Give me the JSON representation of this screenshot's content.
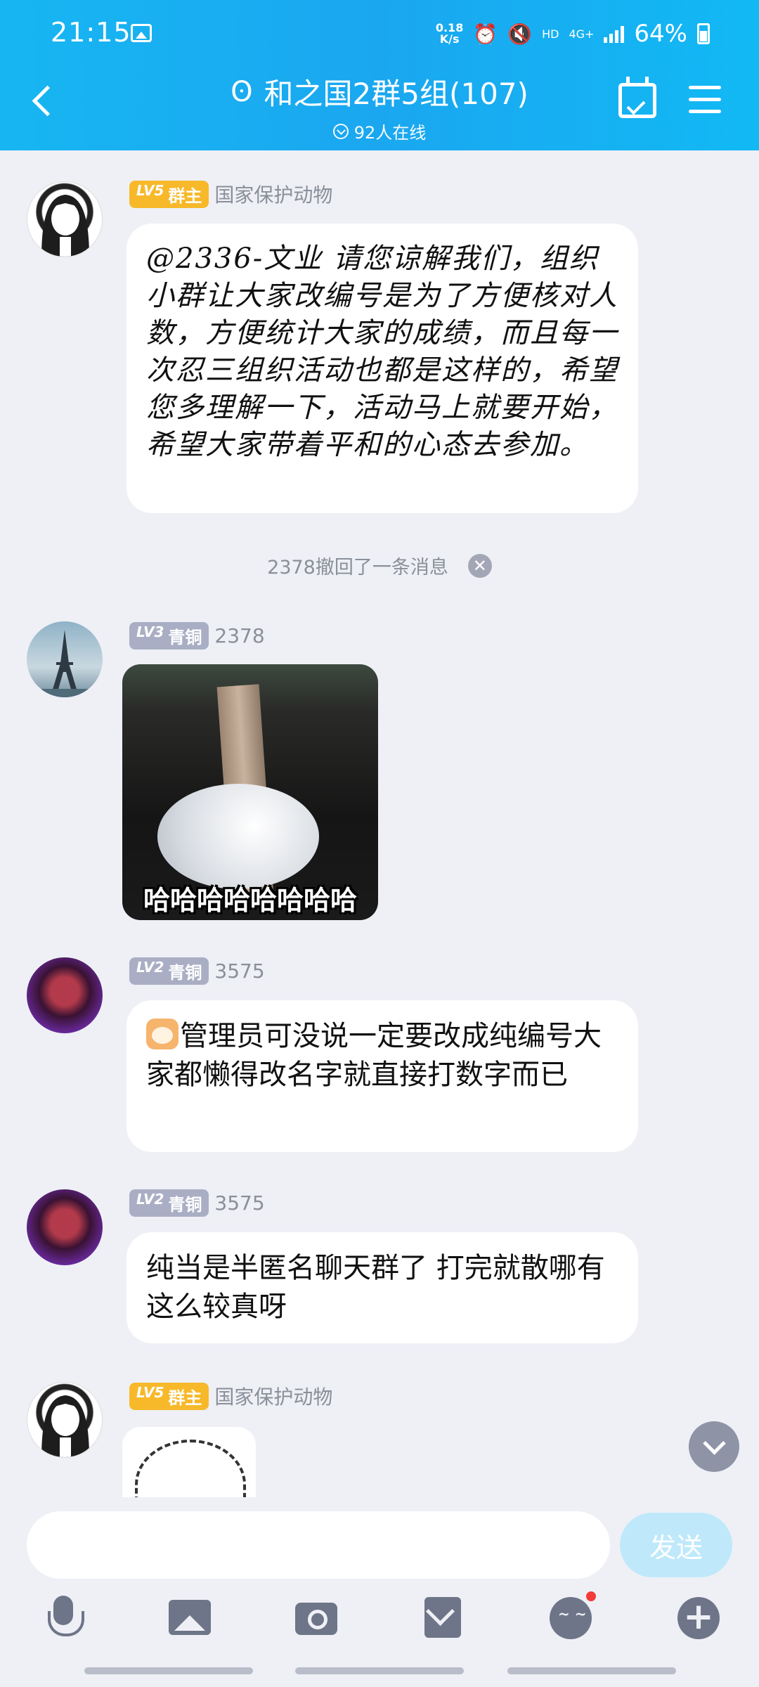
{
  "status_bar": {
    "time": "21:15",
    "speed_value": "0.18",
    "speed_unit": "K/s",
    "hd": "HD",
    "network": "4G+",
    "battery": "64%"
  },
  "header": {
    "title": "和之国2群5组(107)",
    "online": "92人在线"
  },
  "messages": [
    {
      "level": "LV5",
      "role": "群主",
      "name": "国家保护动物",
      "text": "@2336-文业 请您谅解我们，组织小群让大家改编号是为了方便核对人数，方便统计大家的成绩，而且每一次忍三组织活动也都是这样的，希望您多理解一下，活动马上就要开始，希望大家带着平和的心态去参加。"
    },
    {
      "notice": "2378撤回了一条消息"
    },
    {
      "level": "LV3",
      "role": "青铜",
      "name": "2378",
      "sticker_caption": "哈哈哈哈哈哈哈哈"
    },
    {
      "level": "LV2",
      "role": "青铜",
      "name": "3575",
      "text": "管理员可没说一定要改成纯编号大家都懒得改名字就直接打数字而已"
    },
    {
      "level": "LV2",
      "role": "青铜",
      "name": "3575",
      "text": "纯当是半匿名聊天群了 打完就散哪有这么较真呀"
    },
    {
      "level": "LV5",
      "role": "群主",
      "name": "国家保护动物"
    }
  ],
  "input": {
    "placeholder": "",
    "send_label": "发送"
  },
  "colors": {
    "header": "#1aa7f0",
    "owner_badge": "#f7b92a",
    "bronze_badge": "#a9aec4",
    "send_disabled": "#bfe9fb"
  }
}
